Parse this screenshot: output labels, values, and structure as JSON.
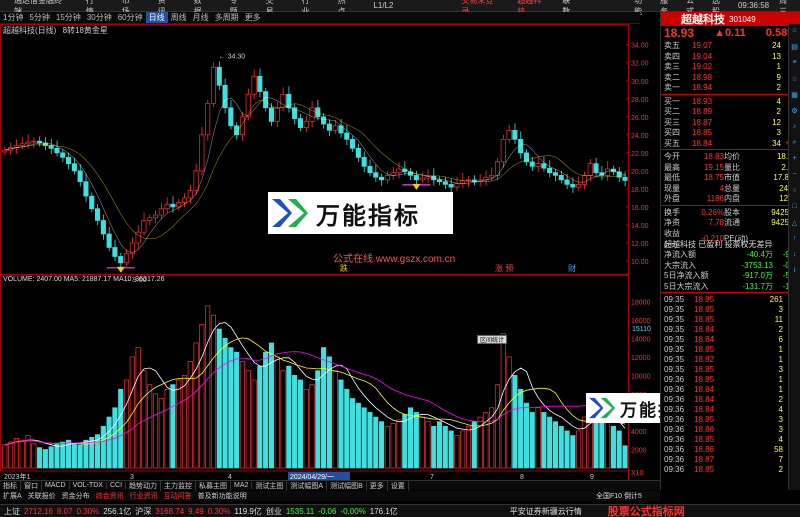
{
  "menubar": {
    "app_title": "通达信金融终端",
    "menus": [
      "行情",
      "市场",
      "资讯",
      "数据",
      "专题",
      "交易",
      "行业",
      "热点",
      "L1/L2"
    ],
    "center_items": [
      "交易未登录",
      "超越科技",
      "联数"
    ],
    "right_items": [
      "功能",
      "服务",
      "公式",
      "选股",
      "09:36:58",
      "周三"
    ]
  },
  "periodbar": {
    "items": [
      "1分钟",
      "5分钟",
      "15分钟",
      "30分钟",
      "60分钟",
      "日线",
      "周线",
      "月线",
      "多周期",
      "更多"
    ],
    "active_index": 5
  },
  "main_chart": {
    "title": "超越科技(日线)",
    "indicator": "8转18黄金星",
    "max_price_label": "34.30",
    "min_price_label": "9.00",
    "y_ticks": [
      "34.00",
      "32.00",
      "30.00",
      "28.00",
      "26.00",
      "24.00",
      "22.00",
      "20.00",
      "18.00",
      "16.00",
      "14.00",
      "12.00",
      "10.00"
    ],
    "marker_labels": [
      "跌",
      "涨 预",
      "财"
    ],
    "watermark_site": "公式在线 www.gszx.com.cn"
  },
  "volume_chart": {
    "header": "VOLUME: 2407.00  MA5: 21887.17  MA10: 36317.26",
    "y_ticks": [
      "18000",
      "16000",
      "14000",
      "12000",
      "10000",
      "8000",
      "6000",
      "4000",
      "2000",
      "X10"
    ],
    "right_tag": "15110",
    "popup_label": "区间统计"
  },
  "time_axis": {
    "labels": [
      "2023年1",
      "3",
      "4",
      "2024/04/29/一",
      "7",
      "8",
      "9"
    ]
  },
  "logo": {
    "text": "万能指标"
  },
  "right_panel": {
    "stock_name": "超越科技",
    "stock_code": "301049",
    "price": "18.93",
    "change": "▲0.11",
    "change_pct": "0.58%",
    "asks": [
      {
        "label": "卖五",
        "price": "19.07",
        "vol": "24",
        "diff": ""
      },
      {
        "label": "卖四",
        "price": "19.04",
        "vol": "13",
        "diff": ""
      },
      {
        "label": "卖三",
        "price": "19.02",
        "vol": "1",
        "diff": "+1"
      },
      {
        "label": "卖二",
        "price": "18.98",
        "vol": "9",
        "diff": ""
      },
      {
        "label": "卖一",
        "price": "18.94",
        "vol": "2",
        "diff": "+2"
      }
    ],
    "bids": [
      {
        "label": "买一",
        "price": "18.93",
        "vol": "4",
        "diff": "-2"
      },
      {
        "label": "买二",
        "price": "18.89",
        "vol": "2",
        "diff": ""
      },
      {
        "label": "买三",
        "price": "18.87",
        "vol": "12",
        "diff": "+1"
      },
      {
        "label": "买四",
        "price": "18.85",
        "vol": "3",
        "diff": ""
      },
      {
        "label": "买五",
        "price": "18.84",
        "vol": "34",
        "diff": "+18"
      }
    ],
    "stats": [
      {
        "l1": "今开",
        "v1": "18.83",
        "l2": "均价",
        "v2": "18.92"
      },
      {
        "l1": "最高",
        "v1": "19.15",
        "l2": "量比",
        "v2": "2.51"
      },
      {
        "l1": "最低",
        "v1": "18.75",
        "l2": "市值",
        "v2": "17.8亿"
      },
      {
        "l1": "现量",
        "v1": "4",
        "l2": "总量",
        "v2": "2407"
      },
      {
        "l1": "外盘",
        "v1": "1186",
        "l2": "内盘",
        "v2": "1221"
      }
    ],
    "stats2": [
      {
        "l1": "换手",
        "v1": "0.26%",
        "l2": "股本",
        "v2": "9425万"
      },
      {
        "l1": "净资",
        "v1": "7.78",
        "l2": "流通",
        "v2": "9425万"
      },
      {
        "l1": "收益(一)",
        "v1": "-0.210",
        "l2": "PE(动)",
        "v2": ""
      }
    ],
    "note": "超越科技 已盈利 投票权无差异",
    "flows": [
      {
        "label": "净流入额",
        "value": "-40.4万",
        "pct": "-9%"
      },
      {
        "label": "大宗流入",
        "value": "-3753.13",
        "pct": "-0%"
      },
      {
        "label": "5日净流入额",
        "value": "-917.0万",
        "pct": "-5%"
      },
      {
        "label": "5日大宗流入",
        "value": "-131.7万",
        "pct": "-1%"
      }
    ],
    "ticks": [
      {
        "t": "09:35",
        "p": "18.85",
        "q": "261",
        "bs": "S"
      },
      {
        "t": "09:35",
        "p": "18.85",
        "q": "3",
        "bs": "S"
      },
      {
        "t": "09:35",
        "p": "18.85",
        "q": "11",
        "bs": "B"
      },
      {
        "t": "09:35",
        "p": "18.84",
        "q": "2",
        "bs": "B"
      },
      {
        "t": "09:35",
        "p": "18.84",
        "q": "6",
        "bs": "S"
      },
      {
        "t": "09:35",
        "p": "18.85",
        "q": "1",
        "bs": "B"
      },
      {
        "t": "09:35",
        "p": "18.82",
        "q": "1",
        "bs": "S"
      },
      {
        "t": "09:35",
        "p": "18.85",
        "q": "3",
        "bs": "B"
      },
      {
        "t": "09:36",
        "p": "18.85",
        "q": "1",
        "bs": "B"
      },
      {
        "t": "09:36",
        "p": "18.84",
        "q": "1",
        "bs": "S"
      },
      {
        "t": "09:36",
        "p": "18.84",
        "q": "2",
        "bs": "B"
      },
      {
        "t": "09:36",
        "p": "18.84",
        "q": "4",
        "bs": "S"
      },
      {
        "t": "09:36",
        "p": "18.85",
        "q": "3",
        "bs": "S"
      },
      {
        "t": "09:36",
        "p": "18.86",
        "q": "3",
        "bs": "B"
      },
      {
        "t": "09:36",
        "p": "18.85",
        "q": "4",
        "bs": "S"
      },
      {
        "t": "09:36",
        "p": "18.86",
        "q": "58",
        "bs": "B"
      },
      {
        "t": "09:36",
        "p": "18.87",
        "q": "7",
        "bs": "B"
      },
      {
        "t": "09:36",
        "p": "18.85",
        "q": "2",
        "bs": "S"
      }
    ]
  },
  "tabs1": [
    "指标",
    "窗口",
    "MACD",
    "VOL-TDX",
    "CCI",
    "趋势动力",
    "主力监控",
    "私募主图",
    "MA2",
    "测试主图",
    "测试幅图A",
    "测试幅图B",
    "更多",
    "设置"
  ],
  "tabs2": [
    "扩展A",
    "关联报价",
    "资金分布",
    "综合资讯",
    "行业资讯",
    "互动问答",
    "普及新功能说明"
  ],
  "tabs2_right": "全国F10  倒计5",
  "ticker": {
    "items": [
      {
        "name": "上证",
        "val": "2712.16",
        "chg": "8.07",
        "pct": "0.30%",
        "amt": "256.1亿",
        "dir": "up"
      },
      {
        "name": "沪深",
        "val": "3168.74",
        "chg": "9.49",
        "pct": "0.30%",
        "amt": "119.9亿",
        "dir": "up"
      },
      {
        "name": "创业",
        "val": "1535.11",
        "chg": "-0.06",
        "pct": "-0.00%",
        "amt": "176.1亿",
        "dir": "dn"
      }
    ],
    "right_text": "平安证券新疆云行情",
    "brand": "股票公式指标网"
  },
  "colors": {
    "up": "#ff3030",
    "down": "#40e0e0",
    "ma5": "#ffffff",
    "ma10": "#ffff00",
    "ma20": "#ff00ff"
  },
  "chart_data": {
    "type": "candlestick",
    "price_range": [
      9.0,
      34.3
    ],
    "closes": [
      22.3,
      22.6,
      22.8,
      23.0,
      23.2,
      23.3,
      23.1,
      22.8,
      22.5,
      22.0,
      21.5,
      20.8,
      20.0,
      18.8,
      17.2,
      15.8,
      14.5,
      13.0,
      11.5,
      10.5,
      9.8,
      10.8,
      12.0,
      13.2,
      14.5,
      14.8,
      15.1,
      15.8,
      16.3,
      16.0,
      16.5,
      17.0,
      17.8,
      20.0,
      24.0,
      27.5,
      31.5,
      29.5,
      27.0,
      25.0,
      24.0,
      26.0,
      28.5,
      30.5,
      28.8,
      27.0,
      25.5,
      27.0,
      28.5,
      27.0,
      25.8,
      24.8,
      25.5,
      27.0,
      26.0,
      25.2,
      24.5,
      25.0,
      24.2,
      23.5,
      22.5,
      21.5,
      20.5,
      19.8,
      19.3,
      19.0,
      19.5,
      19.8,
      20.2,
      19.9,
      19.5,
      19.0,
      19.2,
      19.4,
      19.0,
      18.8,
      18.5,
      18.2,
      18.6,
      18.9,
      19.0,
      18.8,
      19.0,
      19.3,
      19.5,
      21.0,
      23.5,
      24.5,
      23.5,
      22.0,
      21.0,
      20.5,
      20.8,
      20.3,
      19.8,
      19.5,
      19.0,
      18.5,
      18.2,
      18.5,
      19.5,
      20.8,
      19.8,
      19.5,
      20.2,
      19.9,
      19.3,
      18.93
    ],
    "volumes": [
      2.5,
      2.8,
      3.2,
      3.0,
      3.5,
      2.6,
      2.2,
      2.0,
      2.3,
      2.6,
      2.8,
      3.0,
      2.7,
      2.5,
      3.0,
      3.3,
      3.6,
      4.5,
      5.5,
      6.5,
      8.5,
      9.5,
      12.0,
      13.0,
      10.5,
      9.0,
      8.0,
      7.5,
      8.5,
      9.0,
      9.5,
      10.0,
      11.5,
      13.5,
      15.5,
      17.5,
      16.5,
      15.0,
      14.0,
      13.0,
      12.5,
      11.5,
      10.5,
      9.5,
      11.0,
      12.5,
      13.5,
      12.0,
      10.5,
      11.0,
      10.0,
      9.5,
      8.5,
      9.0,
      10.5,
      13.0,
      12.0,
      10.5,
      9.5,
      8.5,
      7.5,
      7.0,
      6.5,
      6.0,
      5.5,
      5.0,
      4.5,
      4.8,
      5.2,
      5.8,
      6.5,
      6.0,
      5.5,
      5.0,
      4.5,
      5.0,
      4.5,
      4.0,
      3.5,
      4.0,
      4.5,
      5.0,
      5.5,
      6.0,
      6.5,
      9.0,
      14.5,
      12.0,
      10.0,
      8.5,
      7.0,
      6.0,
      6.5,
      6.0,
      5.5,
      5.0,
      4.5,
      4.0,
      3.5,
      4.0,
      5.5,
      7.0,
      6.0,
      5.5,
      5.0,
      4.5,
      4.0,
      2.4
    ],
    "volume_range": [
      0,
      19000
    ]
  }
}
